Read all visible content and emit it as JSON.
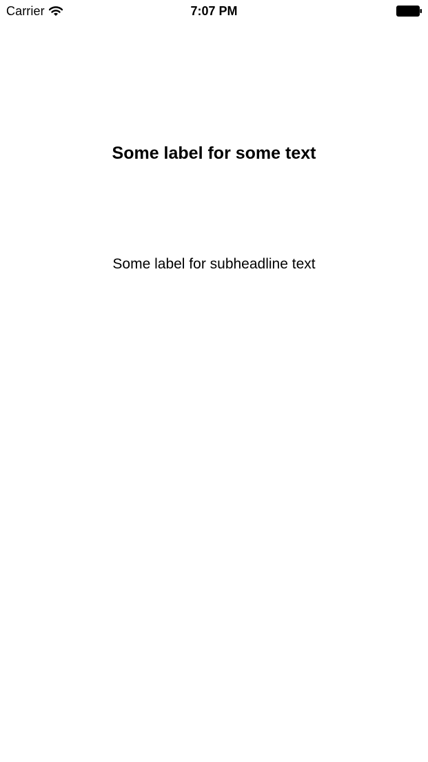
{
  "status_bar": {
    "carrier": "Carrier",
    "time": "7:07 PM",
    "wifi_icon": "wifi-icon",
    "battery_icon": "battery-icon"
  },
  "content": {
    "headline": "Some label for some text",
    "subheadline": "Some label for subheadline text"
  }
}
